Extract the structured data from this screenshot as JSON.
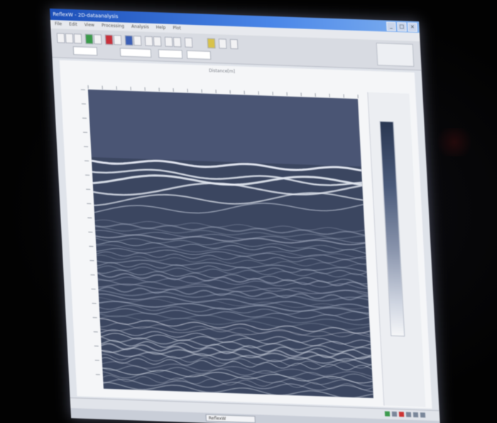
{
  "window": {
    "title": "ReflexW - 2D-dataanalysis",
    "controls": [
      "_",
      "□",
      "×"
    ]
  },
  "menu": {
    "items": [
      "File",
      "Edit",
      "View",
      "Processing",
      "Analysis",
      "Help",
      "Plot"
    ]
  },
  "toolbar": {
    "icons": [
      "open-icon",
      "save-icon",
      "print-icon",
      "zoom-icon",
      "color-icon",
      "flag-icon"
    ]
  },
  "plot": {
    "title": "Distance[m]",
    "type": "radargram"
  },
  "taskbar": {
    "task_label": "ReflexW"
  },
  "colors": {
    "background": "#3b4660",
    "reflection": "#e8ecf5",
    "window": "#dfe3ea",
    "titlebar": "#1c4fb8"
  }
}
